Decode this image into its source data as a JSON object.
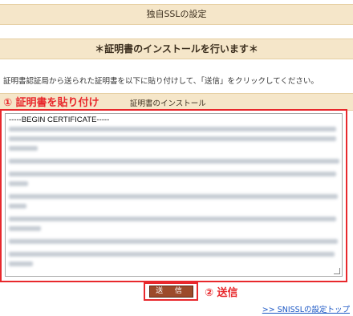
{
  "page_title": "独自SSLの設定",
  "banner_title": "＊証明書のインストールを行います＊",
  "instruction": "証明書認証局から送られた証明書を以下に貼り付けして、「送信」をクリックしてください。",
  "section": {
    "step1_label": "① 証明書を貼り付け",
    "install_label": "証明書のインストール"
  },
  "certificate": {
    "header": "-----BEGIN CERTIFICATE-----"
  },
  "send": {
    "button_label": "送 信",
    "step2_label": "② 送信"
  },
  "top_link": ">> SNISSLの設定トップ",
  "colors": {
    "accent_red": "#e8282c",
    "header_bg": "#f5e6c9",
    "button_bg": "#9c4a2a",
    "link": "#1a56c4"
  }
}
